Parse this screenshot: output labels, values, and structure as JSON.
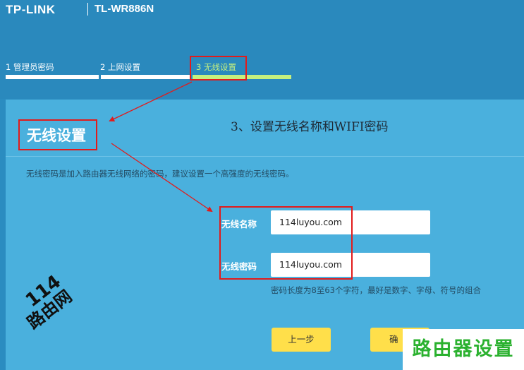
{
  "header": {
    "brand": "TP-LINK",
    "model": "TL-WR886N"
  },
  "steps": [
    {
      "label": "1 管理员密码",
      "state": "done"
    },
    {
      "label": "2 上网设置",
      "state": "done"
    },
    {
      "label": "3 无线设置",
      "state": "current"
    }
  ],
  "colors": {
    "header_bg": "#2a89bd",
    "panel_bg": "#4ab0dd",
    "step_done": "#ffffff",
    "step_current": "#c6f07e",
    "button": "#ffdf4a",
    "annotation_red": "#e21b1b"
  },
  "section": {
    "title": "无线设置",
    "annotation": "3、设置无线名称和WIFI密码",
    "description": "无线密码是加入路由器无线网络的密码，建议设置一个高强度的无线密码。"
  },
  "form": {
    "ssid_label": "无线名称",
    "ssid_value": "114luyou.com",
    "password_label": "无线密码",
    "password_value": "114luyou.com",
    "password_hint": "密码长度为8至63个字符，最好是数字、字母、符号的组合"
  },
  "buttons": {
    "prev": "上一步",
    "confirm": "确"
  },
  "watermark": {
    "number": "114",
    "text": "路由网",
    "badge": "路由器设置"
  }
}
